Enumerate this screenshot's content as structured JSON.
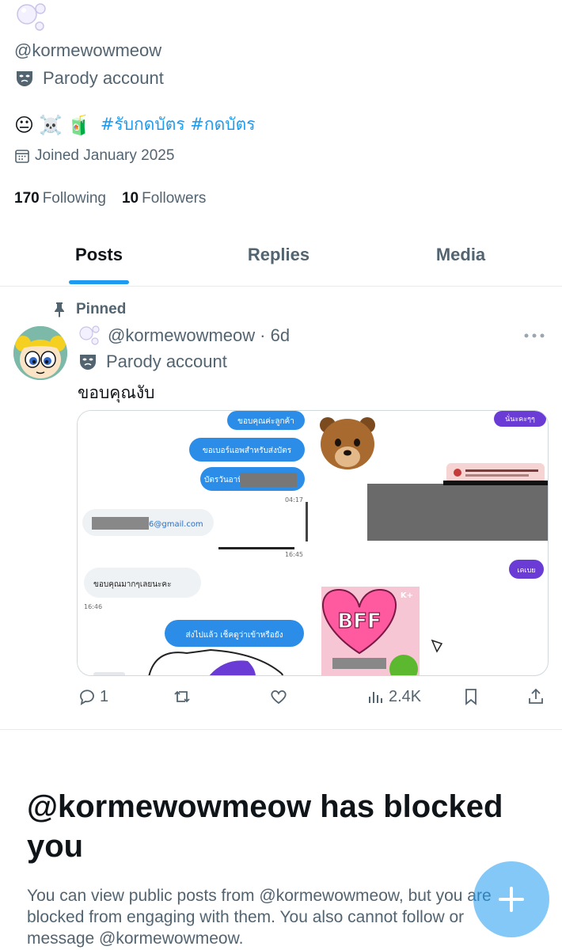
{
  "profile": {
    "handle": "@kormewowmeow",
    "parody_label": "Parody account",
    "bio_emojis": [
      "😐",
      "☠️",
      "🧃"
    ],
    "hashtags": "#รับกดบัตร #กดบัตร",
    "joined": "Joined January 2025",
    "following_count": "170",
    "following_label": "Following",
    "followers_count": "10",
    "followers_label": "Followers"
  },
  "tabs": [
    {
      "label": "Posts",
      "active": true
    },
    {
      "label": "Replies",
      "active": false
    },
    {
      "label": "Media",
      "active": false
    }
  ],
  "post": {
    "pinned_label": "Pinned",
    "handle": "@kormewowmeow",
    "time": "· 6d",
    "parody_label": "Parody account",
    "text": "ขอบคุณงับ",
    "media": {
      "bubbles": {
        "b1": "ขอบคุณค่ะลูกค้า",
        "b2": "ขอเบอร์แอพสำหรับส่งบัตร",
        "b3": "บัตรวันอาทิตย",
        "t1": "04:17",
        "email": "6@gmail.com",
        "t2": "16:45",
        "b4": "ขอบคุณมากๆเลยนะคะ",
        "t3": "16:46",
        "b5": "ส่งไปแล้ว เช็คดูว่าเข้าหรือยัง",
        "right_top": "นั่นะคะๆๆ",
        "right_purple": "เคเบย",
        "bff": "BFF",
        "kplus": "K+"
      }
    },
    "reply_count": "1",
    "views": "2.4K"
  },
  "blocked": {
    "title": "@kormewowmeow has blocked you",
    "description": "You can view public posts from @kormewowmeow, but you are blocked from engaging with them. You also cannot follow or message @kormewowmeow."
  },
  "colors": {
    "accent": "#1d9bf0",
    "muted": "#536471",
    "text": "#0f1419"
  }
}
